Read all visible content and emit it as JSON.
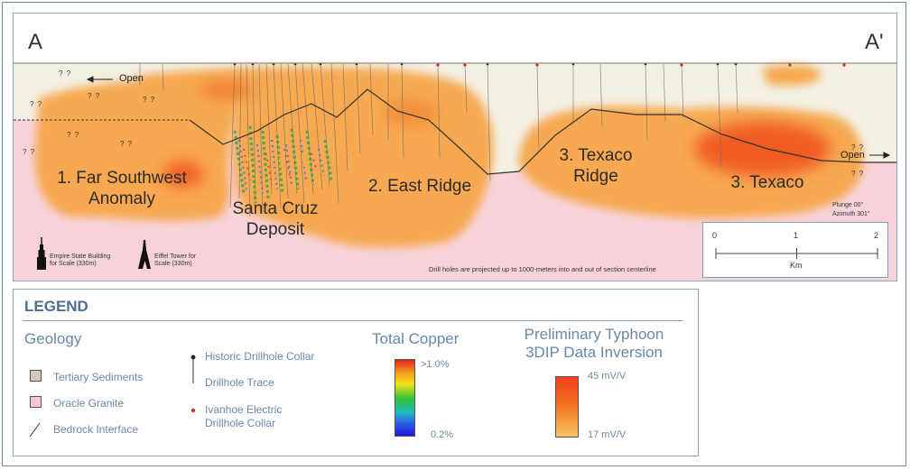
{
  "section": {
    "left_letter": "A",
    "right_letter": "A'",
    "areas": [
      {
        "line1": "1. Far Southwest",
        "line2": "Anomaly"
      },
      {
        "line1": "Santa Cruz",
        "line2": "Deposit"
      },
      {
        "line1": "2. East Ridge",
        "line2": ""
      },
      {
        "line1": "3. Texaco",
        "line2": "Ridge"
      },
      {
        "line1": "3. Texaco",
        "line2": ""
      }
    ],
    "open_left": "Open",
    "open_right": "Open",
    "unknown_mark": "? ?",
    "plunge": "Plunge 00°",
    "azimuth": "Azimuth 301°",
    "footnote": "Drill holes are projected up to 1000-meters into and out of section centerline",
    "empire_caption_1": "Empire State Building",
    "empire_caption_2": "for Scale (330m)",
    "eiffel_caption_1": "Eiffel Tower for",
    "eiffel_caption_2": "Scale (330m)",
    "scale": {
      "ticks": [
        "0",
        "1",
        "2"
      ],
      "unit": "Km"
    }
  },
  "legend": {
    "title": "LEGEND",
    "geology_heading": "Geology",
    "items": [
      "Tertiary Sediments",
      "Oracle Granite",
      "Bedrock Interface"
    ],
    "drill": [
      "Historic Drillhole Collar",
      "Drillhole Trace",
      "Ivanhoe Electric",
      "Drillhole Collar"
    ],
    "copper_heading": "Total Copper",
    "copper_max": ">1.0%",
    "copper_min": "0.2%",
    "ip_heading_1": "Preliminary Typhoon",
    "ip_heading_2": "3DIP Data Inversion",
    "ip_max": "45 mV/V",
    "ip_min": "17 mV/V"
  },
  "colors": {
    "sediment": "#f3efe3",
    "granite": "#f7d3d9",
    "anomaly": "#f7a64a",
    "anomaly_hot": "#f0501c",
    "legend_text": "#6a88a8"
  }
}
